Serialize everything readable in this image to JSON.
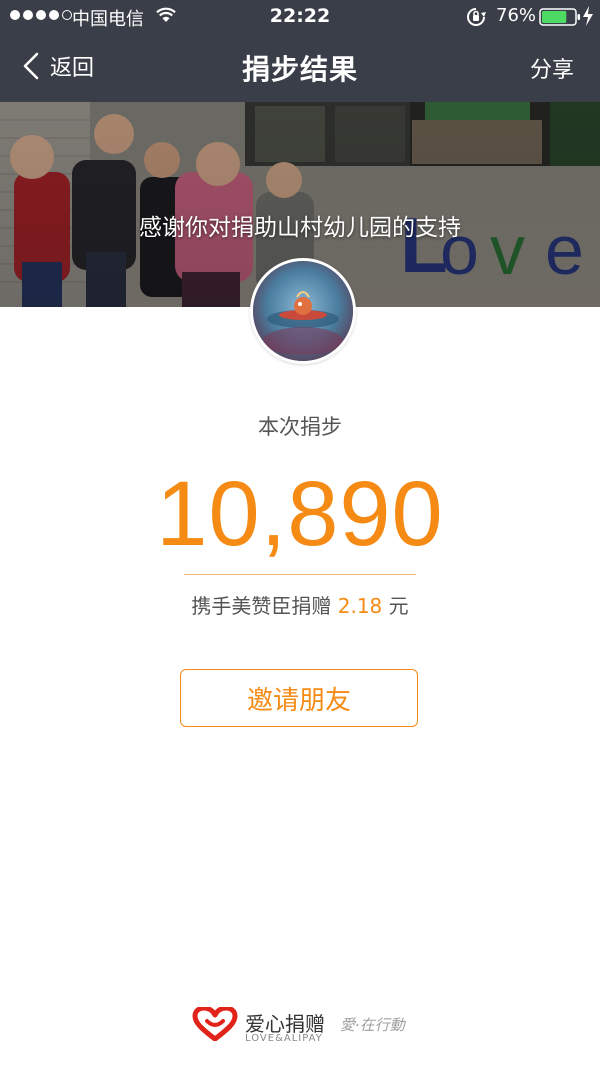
{
  "status_bar": {
    "carrier": "中国电信",
    "time": "22:22",
    "battery": "76%",
    "battery_level": 0.76
  },
  "nav": {
    "back_label": "返回",
    "title": "捐步结果",
    "share_label": "分享"
  },
  "banner": {
    "caption": "感谢你对捐助山村幼儿园的支持"
  },
  "result": {
    "label": "本次捐步",
    "steps": "10,890",
    "donation_prefix": "携手美赞臣捐赠",
    "donation_amount": "2.18",
    "donation_unit": "元"
  },
  "actions": {
    "invite_label": "邀请朋友"
  },
  "footer": {
    "brand_name": "爱心捐赠",
    "brand_sub": "LOVE&ALIPAY",
    "partner_script": "愛·在行動"
  },
  "colors": {
    "header_bg": "#3a3e48",
    "accent": "#f58b14",
    "heart": "#e2231a"
  }
}
